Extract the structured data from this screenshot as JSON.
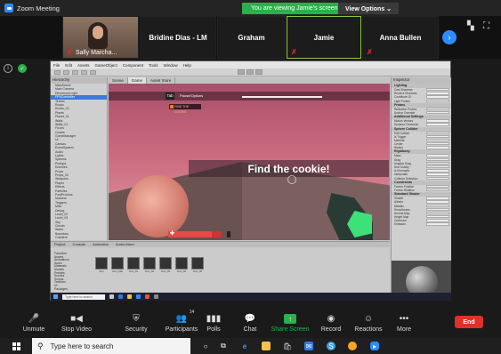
{
  "titlebar": {
    "title": "Zoom Meeting",
    "share_banner": "You are viewing Jamie's screen",
    "view_options": "View Options ⌄"
  },
  "participants": [
    {
      "name": "Sally Marcha...",
      "video": true,
      "muted": true
    },
    {
      "name": "Bridine Dias - LM",
      "video": false,
      "muted": false
    },
    {
      "name": "Graham",
      "video": false,
      "muted": false
    },
    {
      "name": "Jamie",
      "video": false,
      "muted": true,
      "active": true
    },
    {
      "name": "Anna Bullen",
      "video": false,
      "muted": true
    }
  ],
  "unity": {
    "menu": [
      "File",
      "Edit",
      "Assets",
      "GameObject",
      "Component",
      "Tools",
      "Window",
      "Help"
    ],
    "hierarchy_title": "Hierarchy",
    "hierarchy_rows": [
      "MainScene",
      "Main Camera",
      "Directional Light",
      "FPSController",
      "Terrain",
      "Rocks",
      "Rocks_02",
      "Plants",
      "Planet_01",
      "Walls",
      "Walls_02",
      "Floors",
      "Cookie",
      "GameManager",
      "UI",
      "Canvas",
      "EventSystem",
      "Audio",
      "Lights",
      "Spawns",
      "Pickups",
      "Enemies",
      "Props",
      "Props_02",
      "Weapons",
      "Player",
      "Effects",
      "Particles",
      "PostProcess",
      "Markers",
      "Triggers",
      "Misc",
      "Debug",
      "Level_02",
      "Level_03",
      "Sky",
      "Clouds",
      "Water",
      "Boundary",
      "Colliders"
    ],
    "game_tabs": [
      "Scene",
      "Game",
      "Asset Store"
    ],
    "game_tag": "Tab",
    "game_tag_sub": "Pause/Options",
    "score_text": "FIND THE COOKIE",
    "banner": "Find the cookie!",
    "health_fraction": 0.82,
    "inspector_title": "Inspector",
    "inspector_sections": [
      "Lighting",
      "Probes",
      "Additional Settings",
      "Sphere Collider",
      "Rigidbody",
      "Constraints",
      "Standard Shader"
    ],
    "inspector_rows": [
      "Cast Shadows",
      "Receive Shadows",
      "Contribute GI",
      "Light Probes",
      "Reflection Probes",
      "Anchor Override",
      "Motion Vectors",
      "Dynamic Occlusion",
      "Edit Collider",
      "Is Trigger",
      "Material",
      "Center",
      "Radius",
      "Mass",
      "Drag",
      "Angular Drag",
      "Use Gravity",
      "Is Kinematic",
      "Interpolate",
      "Collision Detection",
      "Freeze Position",
      "Freeze Rotation",
      "Shader",
      "Albedo",
      "Metallic",
      "Smoothness",
      "Normal Map",
      "Height Map",
      "Occlusion",
      "Emission"
    ],
    "project_tabs": [
      "Project",
      "Console",
      "Animation",
      "Audio Mixer"
    ],
    "project_tree": [
      "Favorites",
      "Assets",
      "Animations",
      "Audio",
      "Materials",
      "Models",
      "Prefabs",
      "Scenes",
      "Scripts",
      "Textures",
      "UI",
      "Packages"
    ],
    "assets": [
      "Gun",
      "Gun_Mat",
      "Gun_01",
      "Gun_02",
      "Gun_03",
      "Gun_04",
      "Gun_05"
    ]
  },
  "controls": {
    "unmute": "Unmute",
    "stop_video": "Stop Video",
    "security": "Security",
    "participants": "Participants",
    "participants_count": "14",
    "polls": "Polls",
    "chat": "Chat",
    "share_screen": "Share Screen",
    "record": "Record",
    "reactions": "Reactions",
    "more": "More",
    "end": "End"
  },
  "taskbar": {
    "search_placeholder": "Type here to search"
  }
}
